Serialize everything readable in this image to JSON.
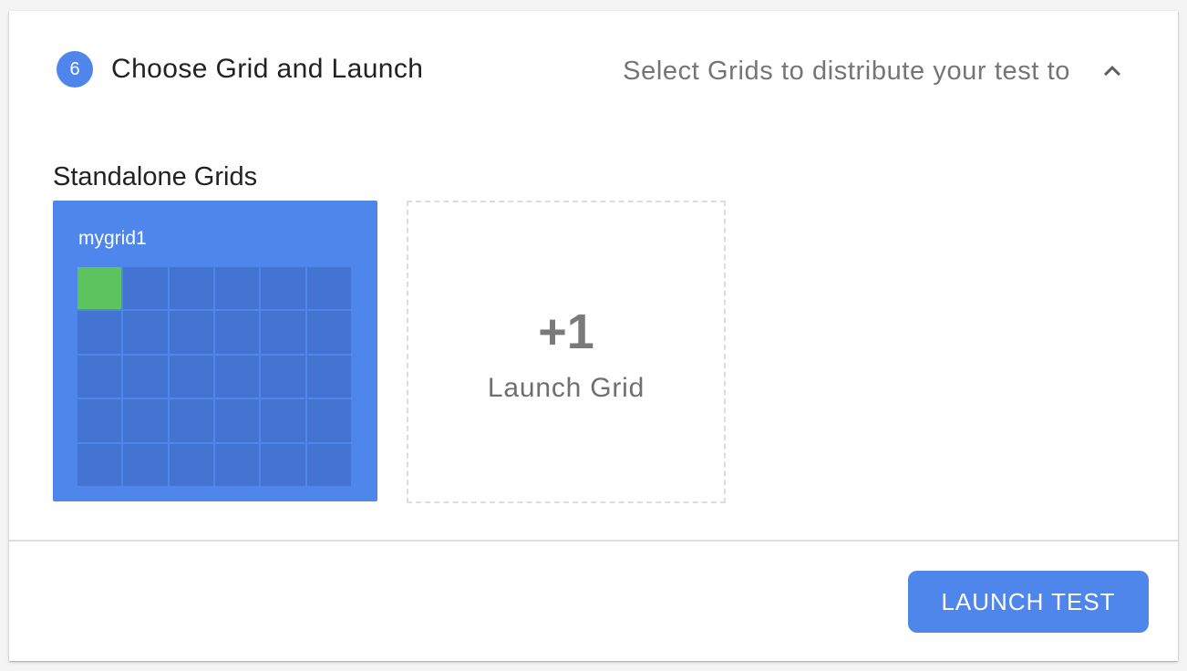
{
  "step": {
    "number": "6",
    "title": "Choose Grid and Launch",
    "subtitle": "Select Grids to distribute your test to",
    "collapse_icon": "chevron-up-icon"
  },
  "section": {
    "title": "Standalone Grids"
  },
  "grids": [
    {
      "name": "mygrid1",
      "rows": 5,
      "columns": 6,
      "active_nodes": 1
    }
  ],
  "launch_grid": {
    "count": "+1",
    "label": "Launch Grid"
  },
  "footer": {
    "launch_test_label": "LAUNCH TEST"
  },
  "colors": {
    "accent": "#4f86ec",
    "node_idle": "#4374d2",
    "node_active": "#5dc35f",
    "text_primary": "#222222",
    "text_secondary": "#757575"
  }
}
